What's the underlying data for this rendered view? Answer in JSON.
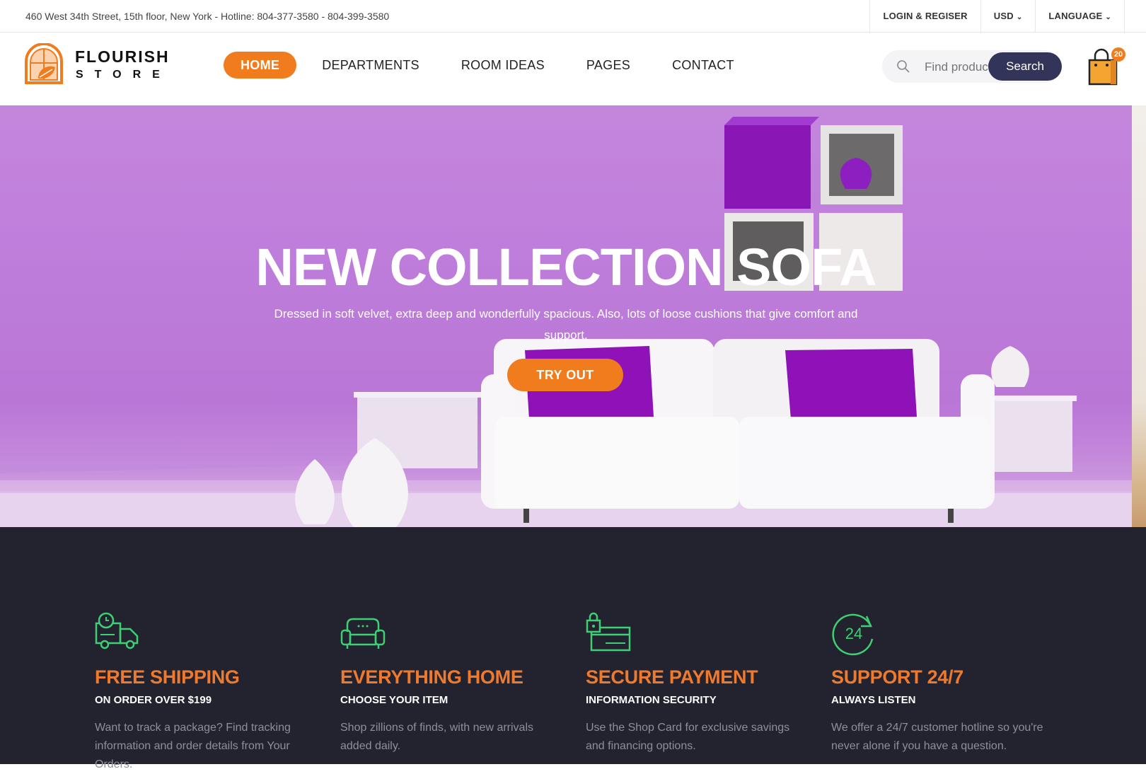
{
  "topbar": {
    "address": "460 West 34th Street, 15th floor, New York - Hotline: 804-377-3580 - 804-399-3580",
    "login": "LOGIN & REGISER",
    "currency": "USD",
    "language": "LANGUAGE"
  },
  "logo": {
    "line1": "FLOURISH",
    "line2": "STORE",
    "icon": "window-leaf-logo"
  },
  "nav": {
    "items": [
      "HOME",
      "DEPARTMENTS",
      "ROOM IDEAS",
      "PAGES",
      "CONTACT"
    ],
    "active": "HOME"
  },
  "search": {
    "placeholder": "Find products",
    "button": "Search",
    "icon": "search-icon"
  },
  "cart": {
    "count": "20",
    "icon": "shopping-bag-icon"
  },
  "hero": {
    "title": "NEW COLLECTION SOFA",
    "subtitle": "Dressed in soft velvet, extra deep and wonderfully spacious. Also, lots of loose cushions that give comfort and support.",
    "button": "TRY OUT"
  },
  "features": [
    {
      "icon": "delivery-truck-icon",
      "title": "FREE SHIPPING",
      "subtitle": "ON ORDER OVER $199",
      "desc": "Want to track a package? Find tracking information and order details from Your Orders."
    },
    {
      "icon": "sofa-icon",
      "title": "EVERYTHING HOME",
      "subtitle": "CHOOSE YOUR ITEM",
      "desc": "Shop zillions of finds, with new arrivals added daily."
    },
    {
      "icon": "secure-card-icon",
      "title": "SECURE PAYMENT",
      "subtitle": "INFORMATION SECURITY",
      "desc": "Use the Shop Card for exclusive savings and financing options."
    },
    {
      "icon": "support-24-icon",
      "title": "SUPPORT 24/7",
      "subtitle": "ALWAYS LISTEN",
      "desc": "We offer a 24/7 customer hotline so you're never alone if you have a question."
    }
  ],
  "colors": {
    "accent": "#f07c1e",
    "dark": "#22232f",
    "navy": "#33345a",
    "green": "#3ecf74"
  }
}
